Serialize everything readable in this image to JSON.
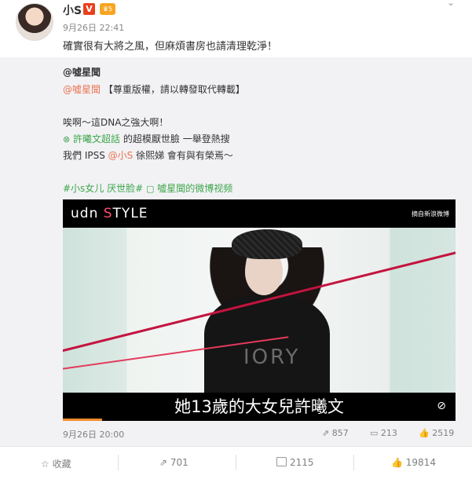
{
  "post": {
    "author": "小S",
    "verified_badge": "V",
    "level_badge": "5",
    "time": "9月26日 22:41",
    "text": "確實很有大將之風，但麻煩書房也請清理乾淨！"
  },
  "repost": {
    "author": "@噓星聞",
    "line1_link": "@噓星聞",
    "line1_rest": "【尊重版權，請以轉發取代轉載】",
    "line2": "唉啊～這DNA之強大啊！",
    "line3_link": "許曦文超話",
    "line3_rest": "的超模厭世臉 一舉登熱搜",
    "line4_pre": "我們 IPSS",
    "line4_link": "@小S",
    "line4_rest": "徐熙娣 會有與有榮焉～",
    "tags": "#小s女儿 厌世脸#",
    "video_link": "噓星聞的微博视频",
    "video": {
      "logo_prefix": "udn",
      "logo_s": "S",
      "logo_suffix": "TYLE",
      "source_tag": "摘自新浪微博",
      "shirt_text": "IORY",
      "subtitle": "她13歲的大女兒許曦文",
      "progress": 0.1
    },
    "time": "9月26日 20:00",
    "reposts": "857",
    "comments": "213",
    "likes": "2519"
  },
  "actions": {
    "favorite": "收藏",
    "repost": "701",
    "comment": "2115",
    "like": "19814"
  },
  "colors": {
    "link": "#eb7350",
    "super_topic": "#3da64a",
    "verified": "#e8401c",
    "progress": "#f28b2c"
  }
}
